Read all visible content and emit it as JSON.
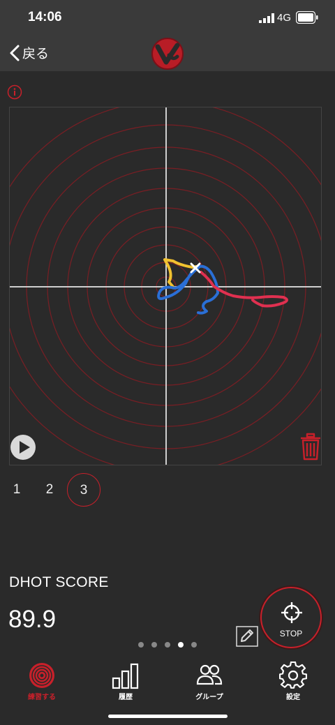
{
  "status": {
    "time": "14:06",
    "network": "4G"
  },
  "nav": {
    "back_label": "戻る"
  },
  "shots": {
    "items": [
      "1",
      "2",
      "3"
    ],
    "selected": "3"
  },
  "score": {
    "label": "DHOT SCORE",
    "value": "89.9"
  },
  "stop_label": "STOP",
  "pager": {
    "count": 5,
    "active_index": 3
  },
  "tabs": [
    {
      "label": "練習する",
      "icon": "target-icon",
      "active": true
    },
    {
      "label": "履歴",
      "icon": "bar-chart-icon",
      "active": false
    },
    {
      "label": "グループ",
      "icon": "group-icon",
      "active": false
    },
    {
      "label": "設定",
      "icon": "gear-icon",
      "active": false
    }
  ],
  "colors": {
    "accent": "#c8202a",
    "background": "#2a2a2a",
    "bar": "#3a3a3a",
    "trace_yellow": "#f2c230",
    "trace_blue": "#2a6fd6",
    "trace_red": "#e03050"
  }
}
